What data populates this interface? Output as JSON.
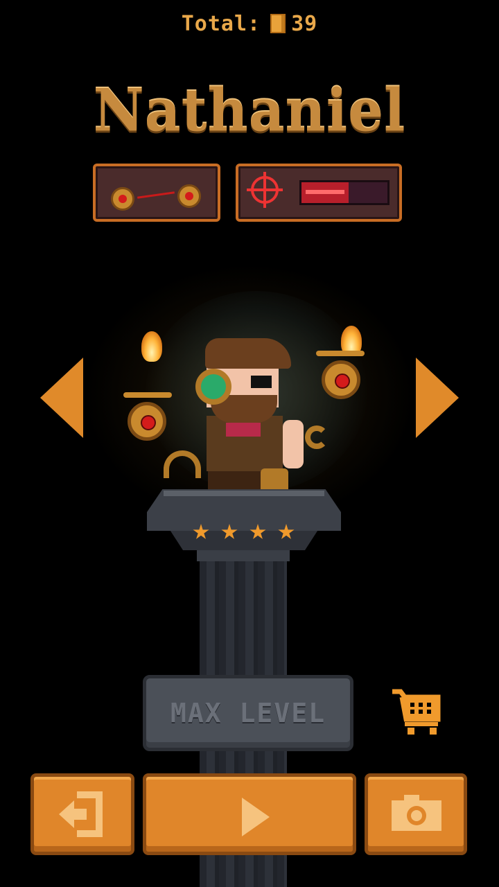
{
  "header": {
    "total_label": "Total:",
    "coins": "39",
    "coin_icon": "coin-icon"
  },
  "character": {
    "name": "Nathaniel",
    "stars": 4
  },
  "abilities": {
    "skill_icon": "drone-laser-icon",
    "weapon_icon": "crosshair-icon",
    "weapon_bar_fraction": 0.55
  },
  "navigation": {
    "prev_icon": "arrow-left-icon",
    "next_icon": "arrow-right-icon"
  },
  "upgrade": {
    "status_label": "MAX LEVEL",
    "shop_icon": "shopping-cart-icon"
  },
  "buttons": {
    "exit_icon": "exit-icon",
    "play_icon": "play-icon",
    "photo_icon": "camera-icon"
  },
  "colors": {
    "accent": "#e0862a",
    "title_gold": "#c68a3e",
    "panel_bg": "#4a2b2b",
    "disabled_gray": "#4b5058"
  }
}
